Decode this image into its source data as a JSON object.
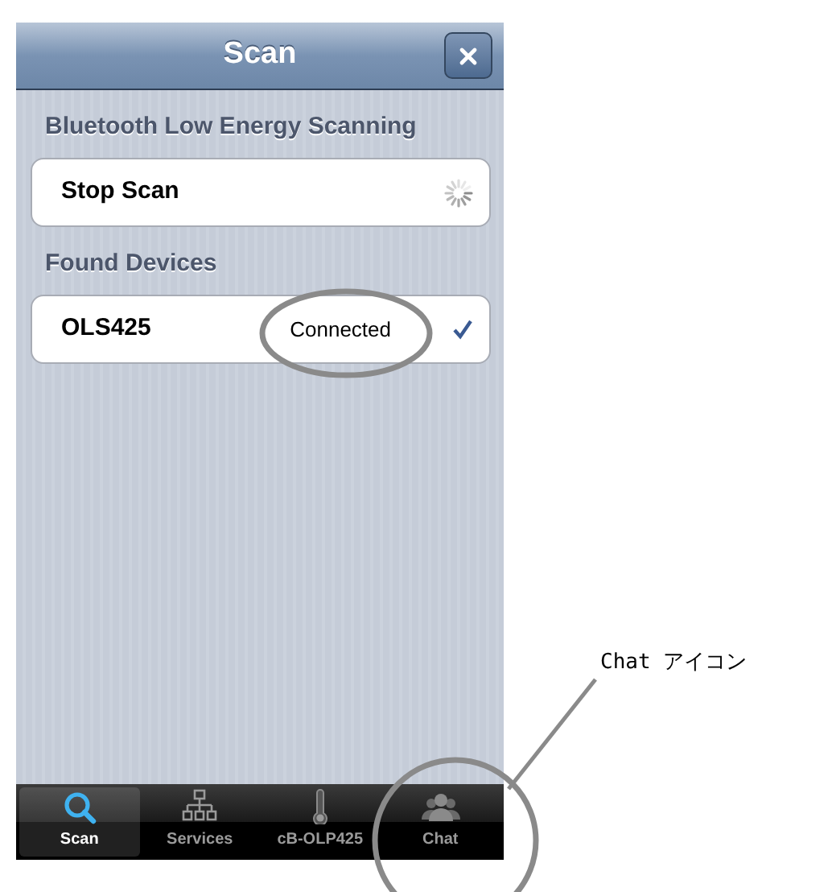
{
  "window": {
    "title": "Scan"
  },
  "sections": [
    {
      "header": "Bluetooth Low Energy Scanning",
      "rows": [
        {
          "kind": "action",
          "label": "Stop Scan",
          "busy": true
        }
      ]
    },
    {
      "header": "Found Devices",
      "rows": [
        {
          "kind": "device",
          "label": "OLS425",
          "status": "Connected",
          "checked": true
        }
      ]
    }
  ],
  "tab_bar": [
    {
      "kind": "search",
      "label": "Scan",
      "selected": true
    },
    {
      "kind": "network",
      "label": "Services",
      "selected": false
    },
    {
      "kind": "thermometer",
      "label": "cB-OLP425",
      "selected": false
    },
    {
      "kind": "people",
      "label": "Chat",
      "selected": false
    }
  ],
  "annotation": {
    "callout": "Chat アイコン"
  }
}
